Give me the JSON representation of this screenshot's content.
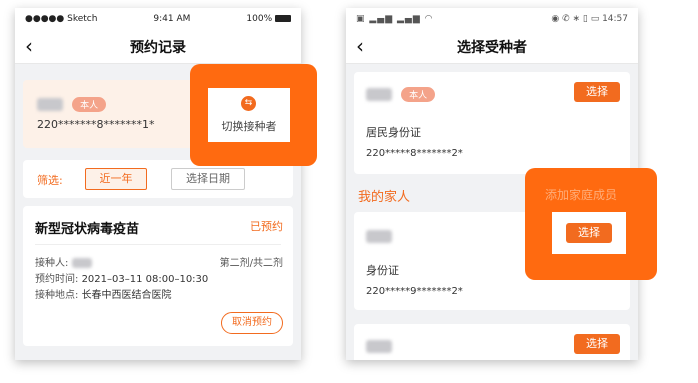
{
  "left": {
    "status": {
      "carrier": "●●●●● Sketch",
      "time": "9:41 AM",
      "battery": "100%"
    },
    "title": "预约记录",
    "self_tag": "本人",
    "id_masked": "220*******8*******1*",
    "switch_label": "切换接种者",
    "filter_label": "筛选:",
    "filter_recent": "近一年",
    "filter_date": "选择日期",
    "vaccine_name": "新型冠状病毒疫苗",
    "status_booked": "已预约",
    "recipient_label": "接种人:",
    "dose_info": "第二剂/共二剂",
    "time_label": "预约时间:",
    "time_value": "2021–03–11 08:00–10:30",
    "location_label": "接种地点:",
    "location_value": "长春中西医结合医院",
    "cancel_label": "取消预约"
  },
  "right": {
    "status": {
      "time": "14:57"
    },
    "title": "选择受种者",
    "self_tag": "本人",
    "select_label": "选择",
    "id_type_1": "居民身份证",
    "id_masked_1": "220*****8*******2*",
    "family_heading": "我的家人",
    "add_family": "添加家庭成员",
    "id_type_2": "身份证",
    "id_masked_2": "220*****9*******2*"
  },
  "colors": {
    "accent": "#f26b1f",
    "overlay": "#ff6a10"
  }
}
